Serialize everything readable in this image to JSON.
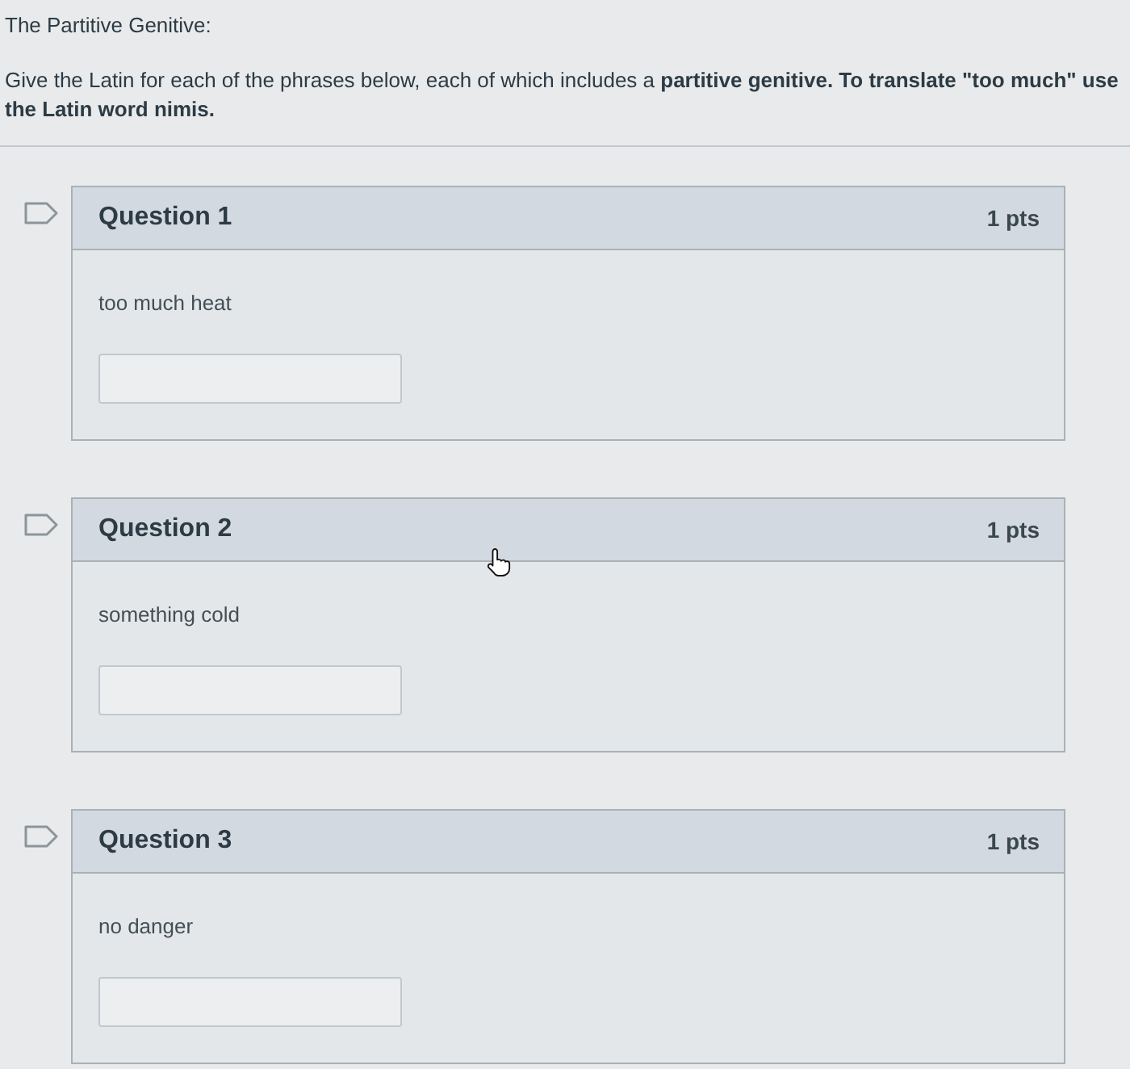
{
  "page": {
    "title": "The Partitive Genitive:",
    "instructions": "Give the Latin for each of the phrases below, each of which includes a **partitive genitive. To translate \"too much\" use the Latin word nimis.**"
  },
  "questions": [
    {
      "title": "Question 1",
      "points": "1 pts",
      "prompt": "too much heat"
    },
    {
      "title": "Question 2",
      "points": "1 pts",
      "prompt": "something cold"
    },
    {
      "title": "Question 3",
      "points": "1 pts",
      "prompt": "no danger"
    }
  ]
}
